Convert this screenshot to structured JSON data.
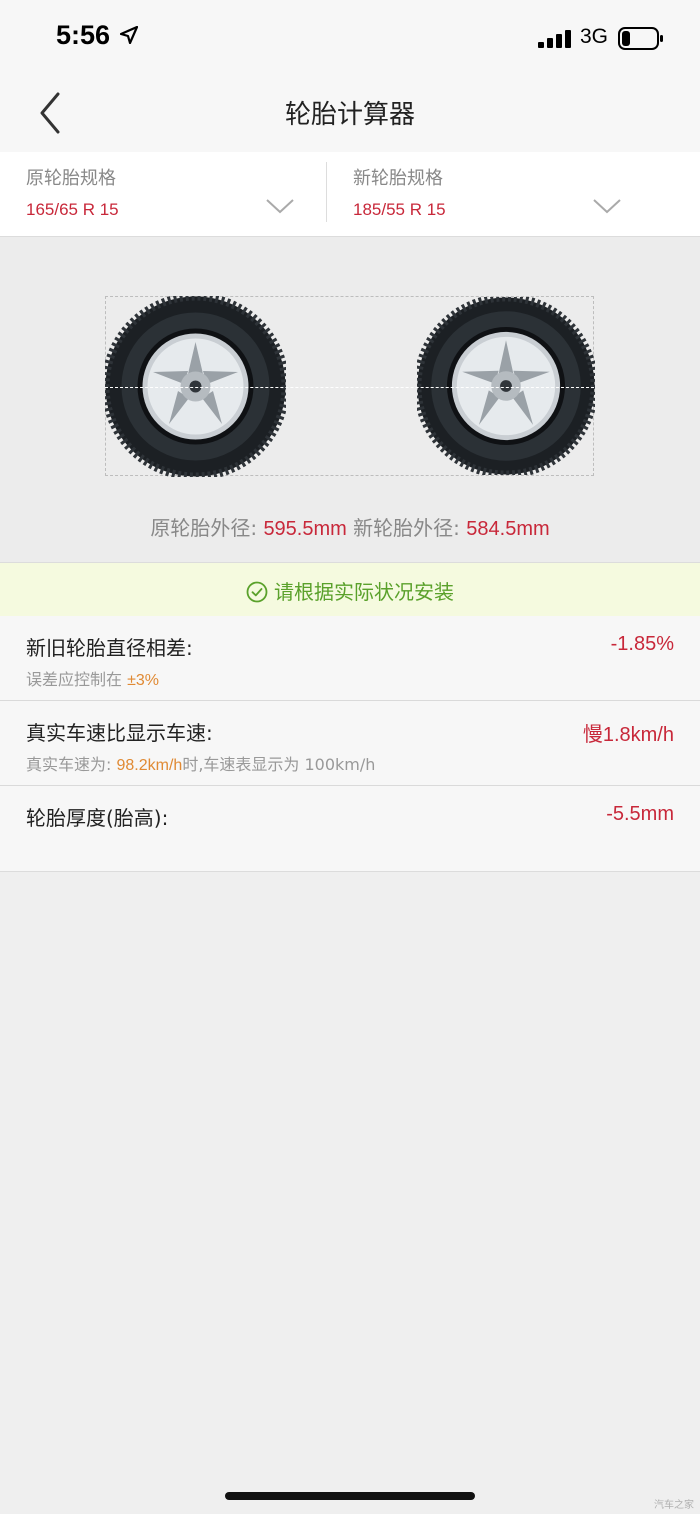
{
  "status": {
    "time": "5:56",
    "network": "3G",
    "icons": [
      "location-arrow-icon",
      "signal-bars-icon",
      "battery-icon"
    ]
  },
  "header": {
    "title": "轮胎计算器",
    "back_icon": "chevron-left-icon"
  },
  "selector": {
    "original_label": "原轮胎规格",
    "original_value": "165/65 R 15",
    "new_label": "新轮胎规格",
    "new_value": "185/55 R 15"
  },
  "diameter": {
    "original_label": "原轮胎外径:",
    "original_value": "595.5mm",
    "new_label": "新轮胎外径:",
    "new_value": "584.5mm"
  },
  "notice": {
    "text": "请根据实际状况安装",
    "icon": "check-circle-icon"
  },
  "results": {
    "diff_title": "新旧轮胎直径相差:",
    "diff_value": "-1.85%",
    "diff_sub_prefix": "误差应控制在",
    "diff_sub_limit": "±3%",
    "speed_title": "真实车速比显示车速:",
    "speed_value": "慢1.8km/h",
    "speed_sub_prefix": "真实车速为:",
    "speed_sub_real": "98.2km/h",
    "speed_sub_suffix": "时,车速表显示为 100km/h",
    "thickness_title": "轮胎厚度(胎高):",
    "thickness_value": "-5.5mm"
  },
  "watermark": "汽车之家",
  "colors": {
    "accent_red": "#c8283a",
    "notice_green": "#5aa12b",
    "notice_bg": "#f5fadf",
    "orange": "#e08a34"
  }
}
